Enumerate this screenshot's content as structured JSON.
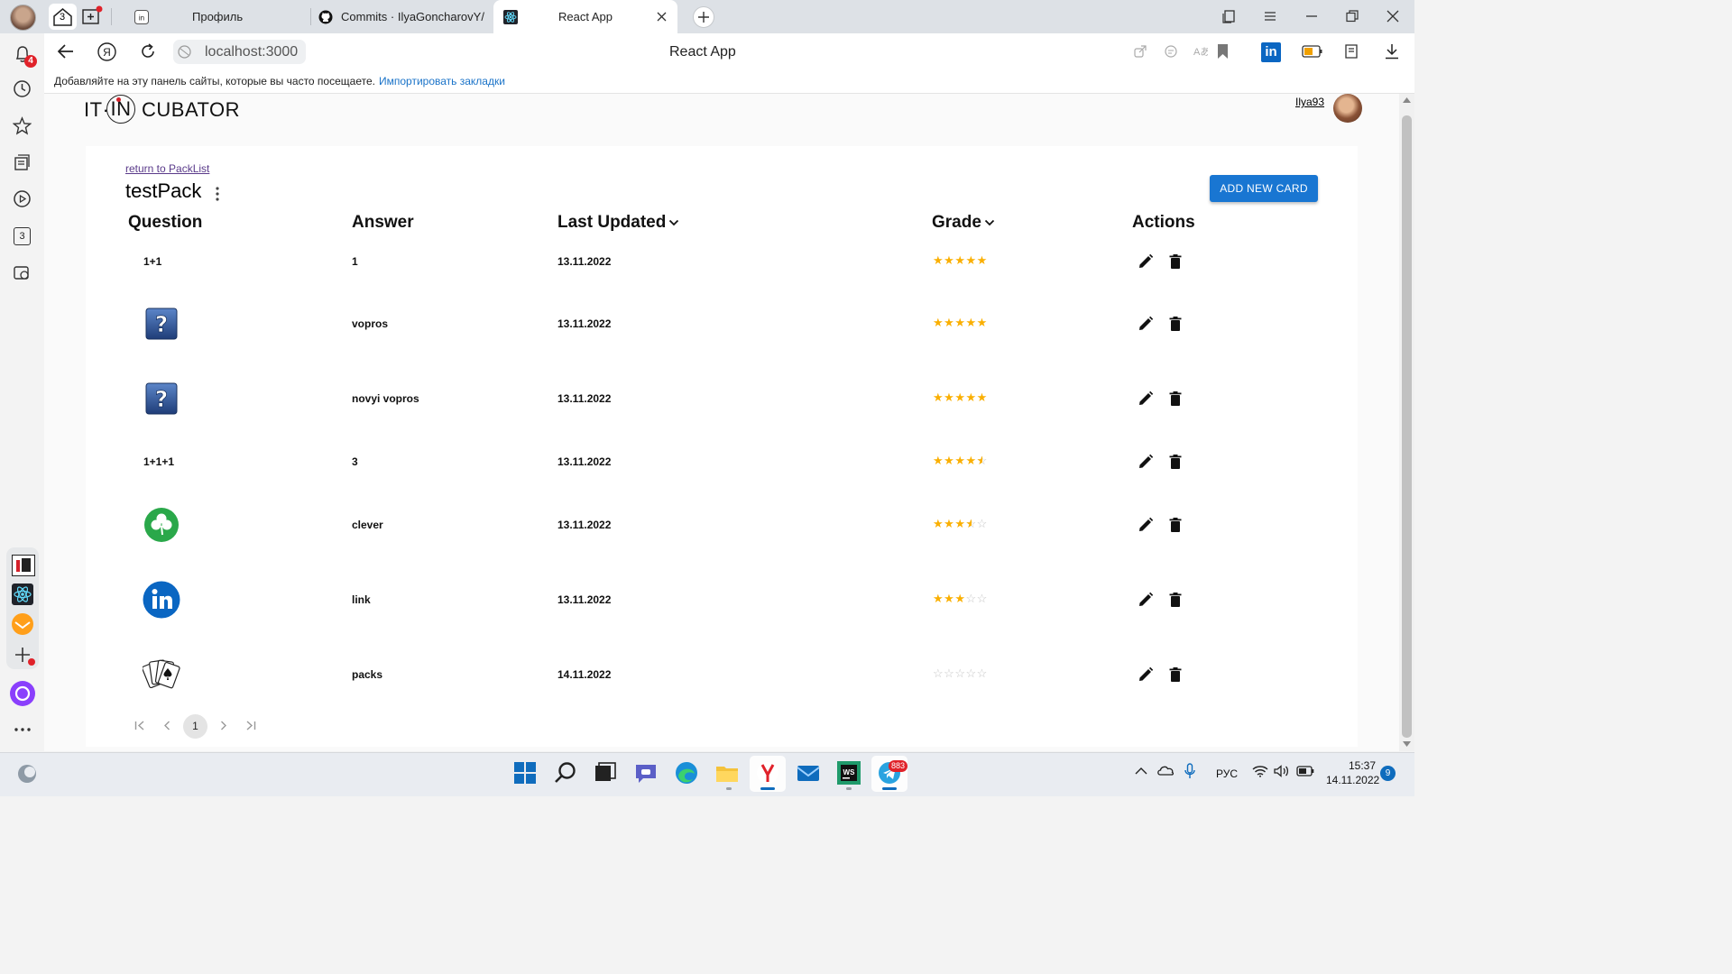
{
  "browser": {
    "tab_home_count": "3",
    "tabs": [
      {
        "title": "Профиль"
      },
      {
        "title": "Commits · IlyaGoncharovY/"
      },
      {
        "title": "React App",
        "active": true
      }
    ],
    "url": "localhost:3000",
    "page_title": "React App",
    "bookmarks_prompt": "Добавляйте на эту панель сайты, которые вы часто посещаете.",
    "bookmarks_import": "Импортировать закладки",
    "sidebar_badge": "4",
    "sidebar_tabs_count": "3"
  },
  "app": {
    "logo": {
      "left": "IT·",
      "mid": "IN",
      "right": "CUBATOR"
    },
    "user_name": "Ilya93",
    "return_link": "return to PackList",
    "pack_title": "testPack",
    "add_button": "ADD NEW CARD",
    "columns": [
      "Question",
      "Answer",
      "Last Updated",
      "Grade",
      "Actions"
    ],
    "rows": [
      {
        "question": "1+1",
        "answer": "1",
        "updated": "13.11.2022",
        "grade": 5
      },
      {
        "question_image": "question-mark-icon",
        "answer": "vopros",
        "updated": "13.11.2022",
        "grade": 5
      },
      {
        "question_image": "question-mark-icon",
        "answer": "novyi vopros",
        "updated": "13.11.2022",
        "grade": 5
      },
      {
        "question": "1+1+1",
        "answer": "3",
        "updated": "13.11.2022",
        "grade": 4.5
      },
      {
        "question_image": "clover-icon",
        "answer": "clever",
        "updated": "13.11.2022",
        "grade": 3.5
      },
      {
        "question_image": "linkedin-icon",
        "answer": "link",
        "updated": "13.11.2022",
        "grade": 3
      },
      {
        "question_image": "playing-cards-icon",
        "answer": "packs",
        "updated": "14.11.2022",
        "grade": 0
      }
    ],
    "pagination": {
      "current": "1"
    }
  },
  "taskbar": {
    "language": "РУС",
    "time": "15:37",
    "date": "14.11.2022",
    "telegram_badge": "883",
    "notifications": "9"
  },
  "colors": {
    "accent": "#1976d2",
    "star": "#faaf00",
    "star_empty": "#c7c7c7"
  }
}
